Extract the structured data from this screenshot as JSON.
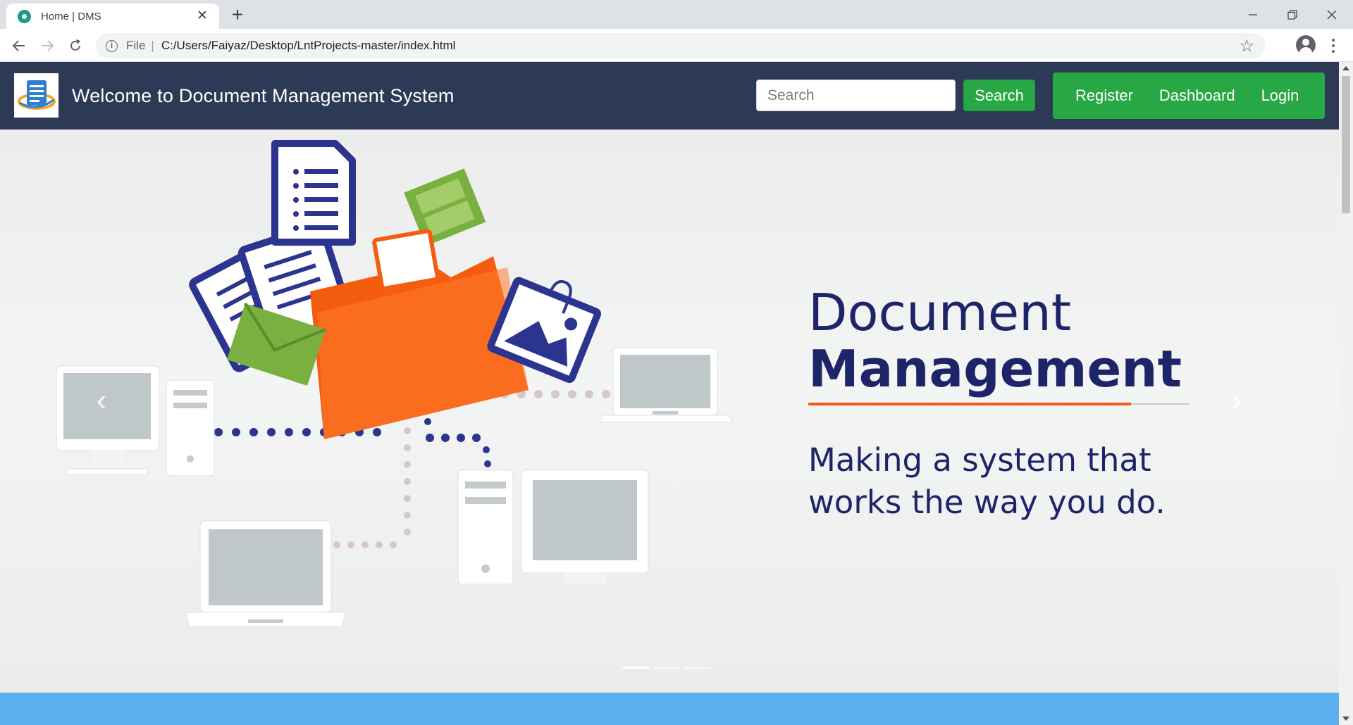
{
  "browser": {
    "tab_title": "Home | DMS",
    "tab_close": "✕",
    "new_tab": "+",
    "window_controls": {
      "minimize": "—",
      "restore": "❐",
      "close": "✕"
    },
    "nav": {
      "back": "←",
      "forward": "→",
      "reload": "↻"
    },
    "address": {
      "info_icon": "i",
      "scheme": "File",
      "separator": "|",
      "url": "C:/Users/Faiyaz/Desktop/LntProjects-master/index.html"
    },
    "bookmark_icon": "☆"
  },
  "site": {
    "brand": "Welcome to Document Management System",
    "search": {
      "placeholder": "Search",
      "button": "Search"
    },
    "nav_links": [
      "Register",
      "Dashboard",
      "Login"
    ]
  },
  "hero": {
    "title_line1": "Document",
    "title_line2": "Management",
    "subtitle_line1": "Making a system that",
    "subtitle_line2": "works the way you do.",
    "prev": "‹",
    "next": "›",
    "slides": 3,
    "active_slide": 1
  },
  "colors": {
    "navbar": "#2c3a55",
    "green": "#28a745",
    "hero_text": "#1e2468",
    "hero_accent": "#f05a14",
    "band": "#5cb0ed",
    "folder": "#f45d10",
    "doc_blue": "#2b3590",
    "envelope": "#7ab040"
  }
}
